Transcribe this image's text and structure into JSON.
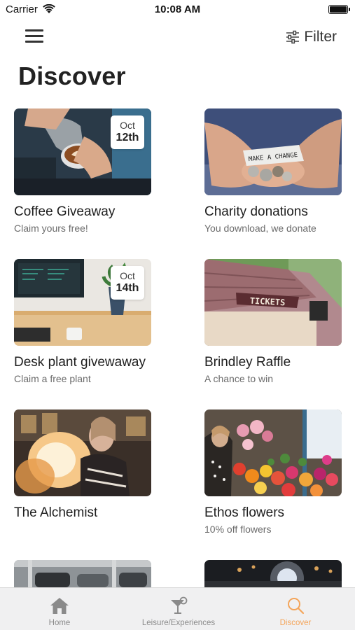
{
  "status_bar": {
    "carrier": "Carrier",
    "time": "10:08 AM"
  },
  "header": {
    "filter_label": "Filter"
  },
  "page": {
    "title": "Discover"
  },
  "cards": [
    {
      "title": "Coffee Giveaway",
      "subtitle": "Claim yours free!",
      "badge": {
        "month": "Oct",
        "day": "12th"
      }
    },
    {
      "title": "Charity donations",
      "subtitle": "You download, we donate",
      "image_text": "MAKE A CHANGE"
    },
    {
      "title": "Desk plant givewaway",
      "subtitle": "Claim a free plant",
      "badge": {
        "month": "Oct",
        "day": "14th"
      }
    },
    {
      "title": "Brindley Raffle",
      "subtitle": "A chance to win",
      "image_text": "TICKETS"
    },
    {
      "title": "The Alchemist",
      "subtitle": ""
    },
    {
      "title": "Ethos flowers",
      "subtitle": "10% off flowers"
    }
  ],
  "tabbar": {
    "tabs": [
      {
        "label": "Home",
        "icon": "home-icon",
        "active": false
      },
      {
        "label": "Leisure/Experiences",
        "icon": "cocktail-icon",
        "active": false
      },
      {
        "label": "Discover",
        "icon": "search-icon",
        "active": true
      }
    ],
    "active_color": "#f4a55a",
    "inactive_color": "#8a8a8a"
  }
}
